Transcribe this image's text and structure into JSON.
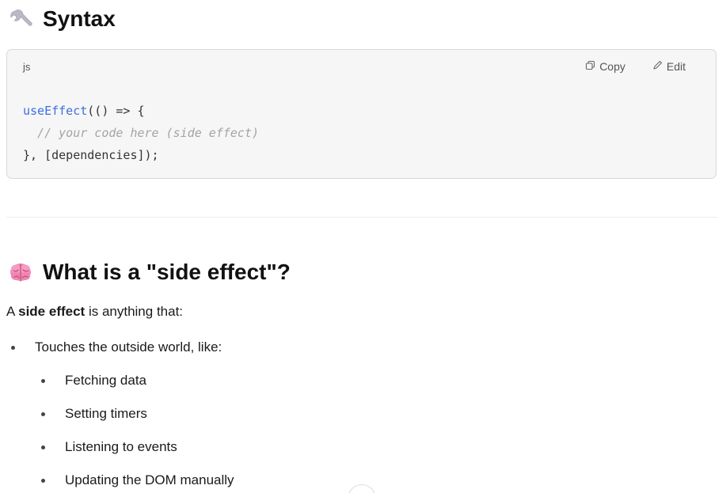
{
  "syntax_section": {
    "title": "Syntax",
    "icon": "wrench-icon"
  },
  "code_block": {
    "language": "js",
    "copy_label": "Copy",
    "edit_label": "Edit",
    "lines": {
      "line1_fn": "useEffect",
      "line1_rest": "(() => {",
      "line2_comment": "  // your code here (side effect)",
      "line3": "}, [dependencies]);"
    },
    "colors": {
      "function": "#3b6fe0",
      "comment": "#a4a4a4"
    }
  },
  "side_effect_section": {
    "title": "What is a \"side effect\"?",
    "icon": "brain-icon",
    "intro_prefix": "A ",
    "intro_bold": "side effect",
    "intro_suffix": " is anything that:",
    "items": [
      {
        "text": "Touches the outside world, like:",
        "sub_items": [
          "Fetching data",
          "Setting timers",
          "Listening to events",
          "Updating the DOM manually"
        ]
      }
    ]
  }
}
